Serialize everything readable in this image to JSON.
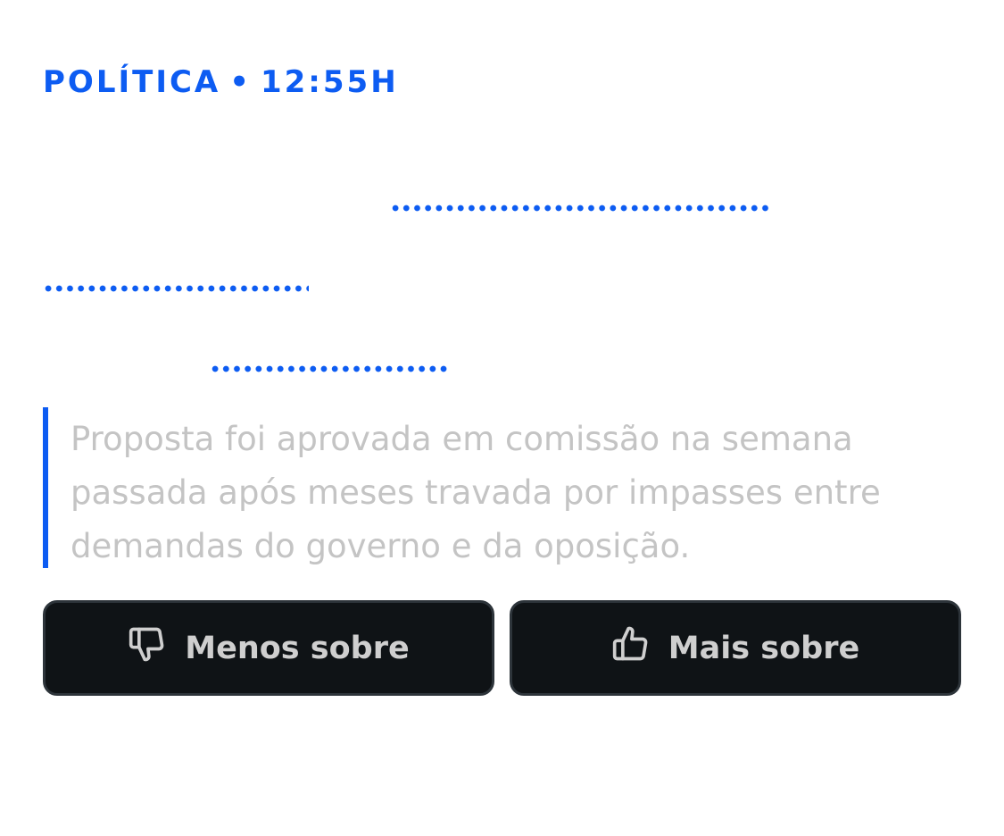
{
  "article": {
    "category": "POLÍTICA",
    "separator": "•",
    "time": "12:55H",
    "summary": "Proposta foi aprovada em comissão na semana passada após meses travada por impasses entre demandas do governo e da oposição."
  },
  "actions": {
    "less_label": "Menos sobre",
    "less_icon": "thumbs-down-icon",
    "more_label": "Mais sobre",
    "more_icon": "thumbs-up-icon"
  },
  "colors": {
    "accent": "#0d5cf2",
    "button_bg": "#0f1316",
    "button_border": "#2d343a",
    "button_text": "#cfcfcf",
    "summary_text": "#c4c4c4"
  }
}
